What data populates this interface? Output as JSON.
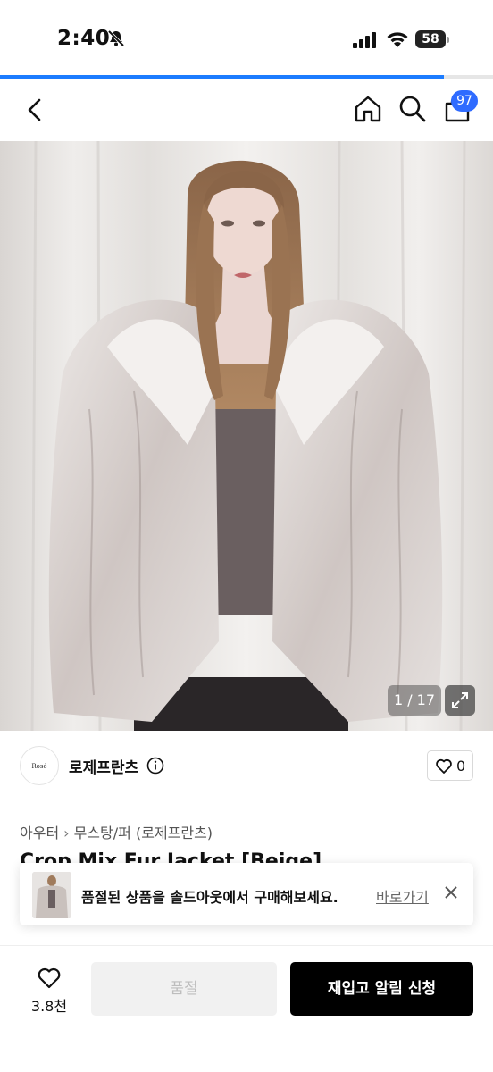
{
  "status_bar": {
    "time": "2:40",
    "battery": "58"
  },
  "page_progress": 0.9,
  "header": {
    "cart_count": "97"
  },
  "gallery": {
    "counter": "1 / 17"
  },
  "seller": {
    "logo_text": "Rosé Frantz",
    "name": "로제프란츠",
    "likes": "0"
  },
  "breadcrumb": {
    "category": "아우터",
    "subcategory": "무스탕/퍼",
    "brand": "(로제프란츠)"
  },
  "product": {
    "title_partial": "Crop Mix Fur Jacket [Beige]"
  },
  "toast": {
    "message": "품절된 상품을 솔드아웃에서 구매해보세요.",
    "link_label": "바로가기"
  },
  "bottom_bar": {
    "wish_count": "3.8천",
    "soldout_label": "품절",
    "restock_label": "재입고 알림 신청"
  },
  "colors": {
    "accent_blue": "#2f6bff",
    "progress_blue": "#1c7cff",
    "primary_button": "#000000"
  }
}
